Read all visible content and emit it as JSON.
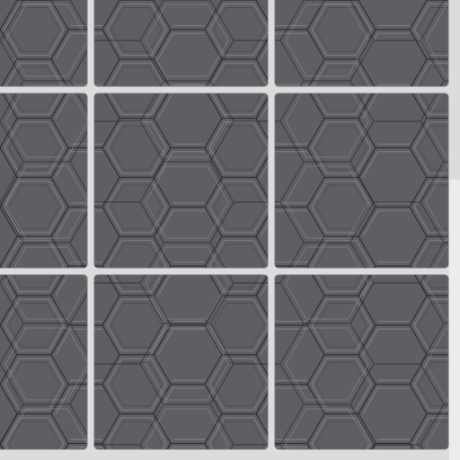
{
  "colors": {
    "grout": "#dcdcdc",
    "tile": "#5f5f63",
    "tile_edge": "#727277",
    "hex_light": "#7d7e86",
    "hex_dark": "#2d3039"
  },
  "tiles": {
    "count": 9,
    "rows": 3,
    "cols": 3
  }
}
